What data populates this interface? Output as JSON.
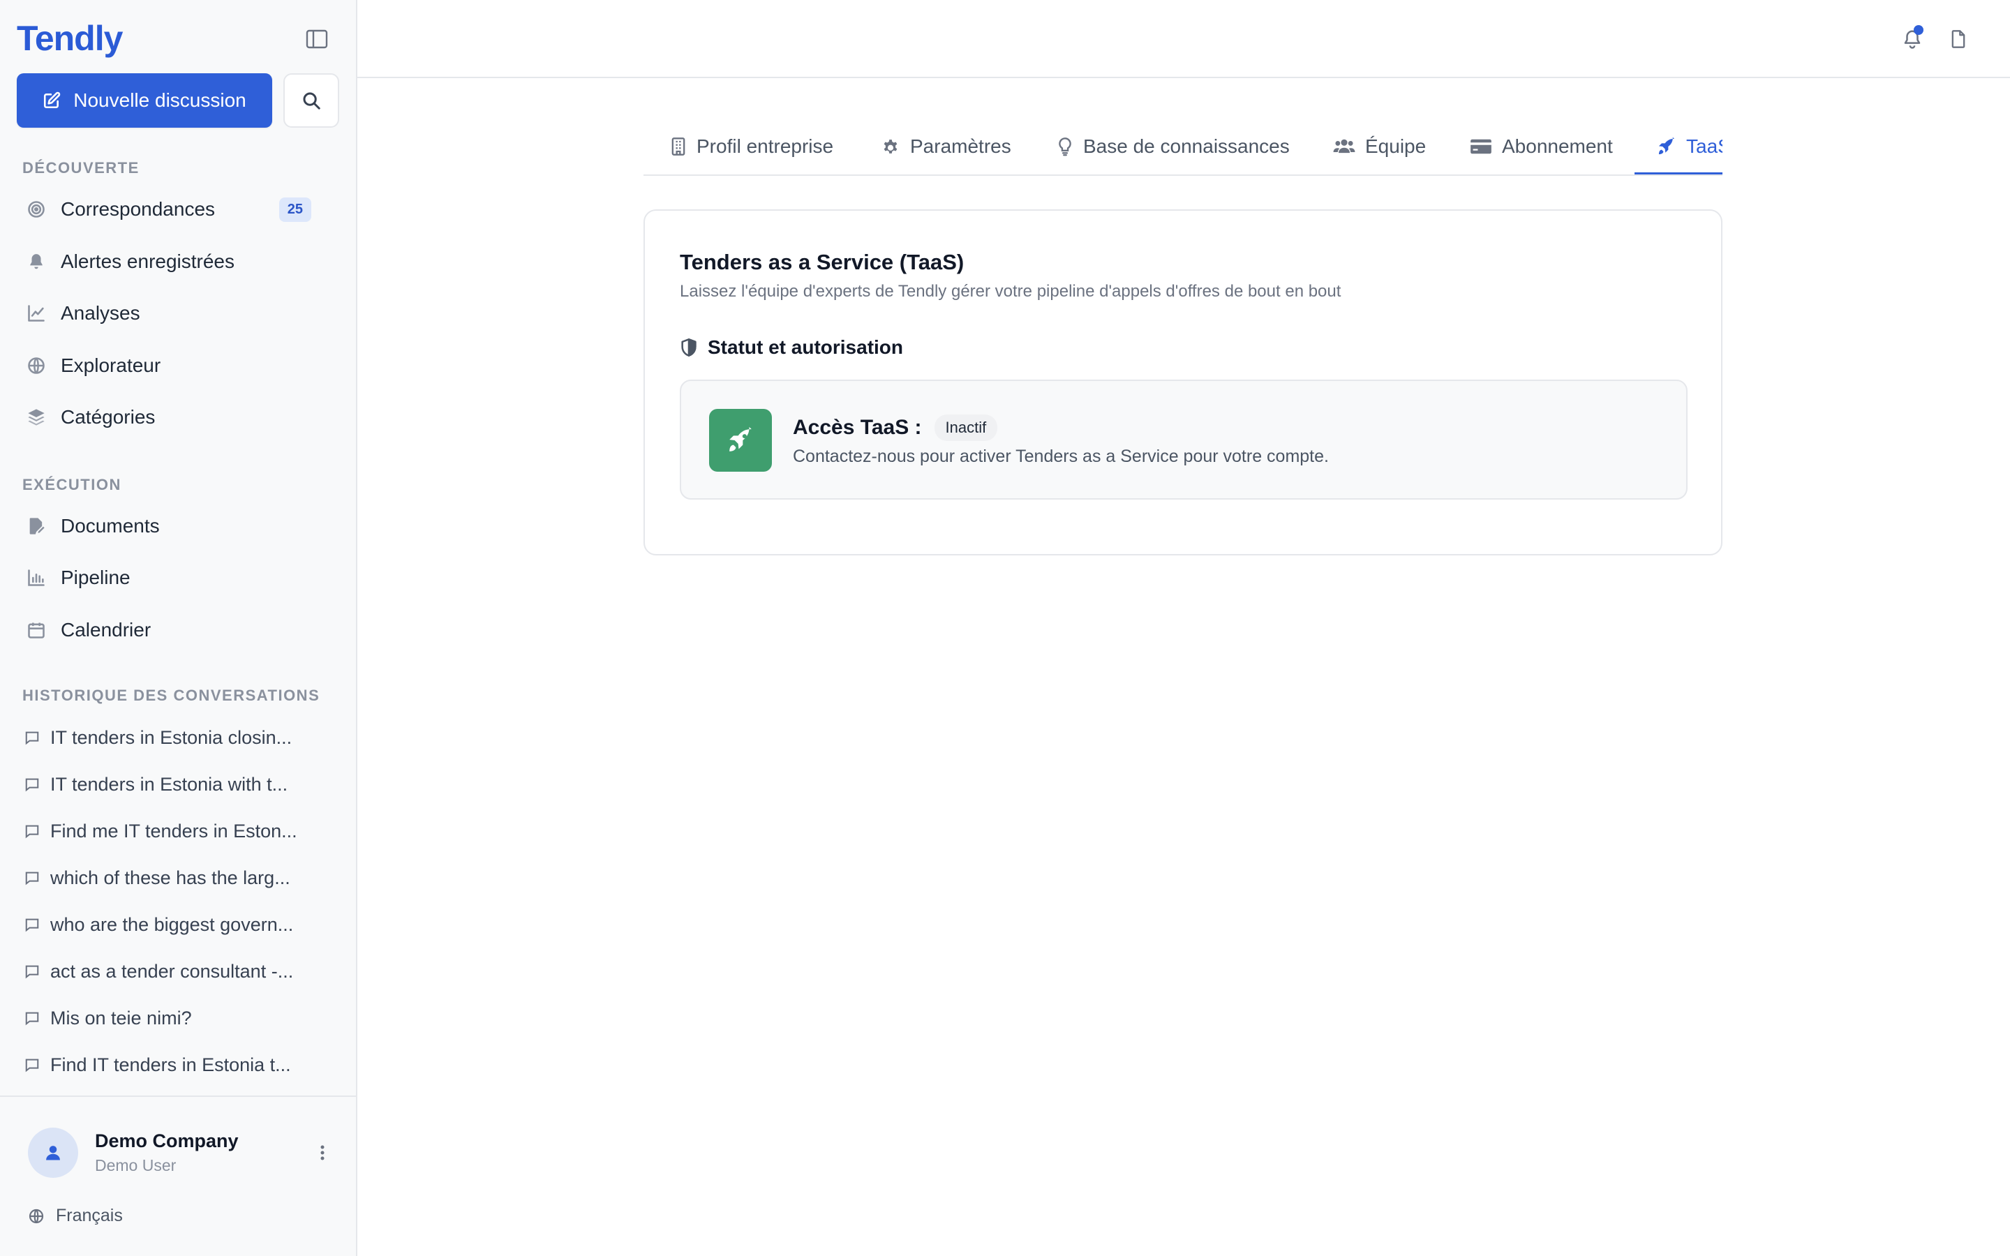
{
  "brand": "Tendly",
  "new_chat_label": "Nouvelle discussion",
  "sections": {
    "discover": "DÉCOUVERTE",
    "execution": "EXÉCUTION",
    "history": "HISTORIQUE DES CONVERSATIONS"
  },
  "discover_items": [
    {
      "label": "Correspondances",
      "icon": "target-icon",
      "badge": "25"
    },
    {
      "label": "Alertes enregistrées",
      "icon": "bell-icon"
    },
    {
      "label": "Analyses",
      "icon": "line-chart-icon"
    },
    {
      "label": "Explorateur",
      "icon": "globe-icon"
    },
    {
      "label": "Catégories",
      "icon": "layers-icon"
    }
  ],
  "execution_items": [
    {
      "label": "Documents",
      "icon": "file-edit-icon"
    },
    {
      "label": "Pipeline",
      "icon": "bar-chart-icon"
    },
    {
      "label": "Calendrier",
      "icon": "calendar-icon"
    }
  ],
  "conversations": [
    "IT tenders in Estonia closin...",
    "IT tenders in Estonia with t...",
    "Find me IT tenders in Eston...",
    "which of these has the larg...",
    "who are the biggest govern...",
    "act as a tender consultant -...",
    "Mis on teie nimi?",
    "Find IT tenders in Estonia t..."
  ],
  "user": {
    "name": "Demo Company",
    "role": "Demo User"
  },
  "language": "Français",
  "tabs": [
    {
      "label": "Profil entreprise",
      "icon": "building-icon"
    },
    {
      "label": "Paramètres",
      "icon": "gear-icon"
    },
    {
      "label": "Base de connaissances",
      "icon": "lightbulb-icon"
    },
    {
      "label": "Équipe",
      "icon": "users-icon"
    },
    {
      "label": "Abonnement",
      "icon": "credit-card-icon"
    },
    {
      "label": "TaaS",
      "icon": "rocket-icon",
      "active": true
    }
  ],
  "card": {
    "title": "Tenders as a Service (TaaS)",
    "subtitle": "Laissez l'équipe d'experts de Tendly gérer votre pipeline d'appels d'offres de bout en bout",
    "status_heading": "Statut et autorisation",
    "access_label": "Accès TaaS :",
    "access_status": "Inactif",
    "access_desc": "Contactez-nous pour activer Tenders as a Service pour votre compte."
  },
  "colors": {
    "accent": "#2f5fd8",
    "brand": "#2b5bd6",
    "rocket_tile": "#3f9e6e",
    "badge_bg": "#dde7fb"
  }
}
